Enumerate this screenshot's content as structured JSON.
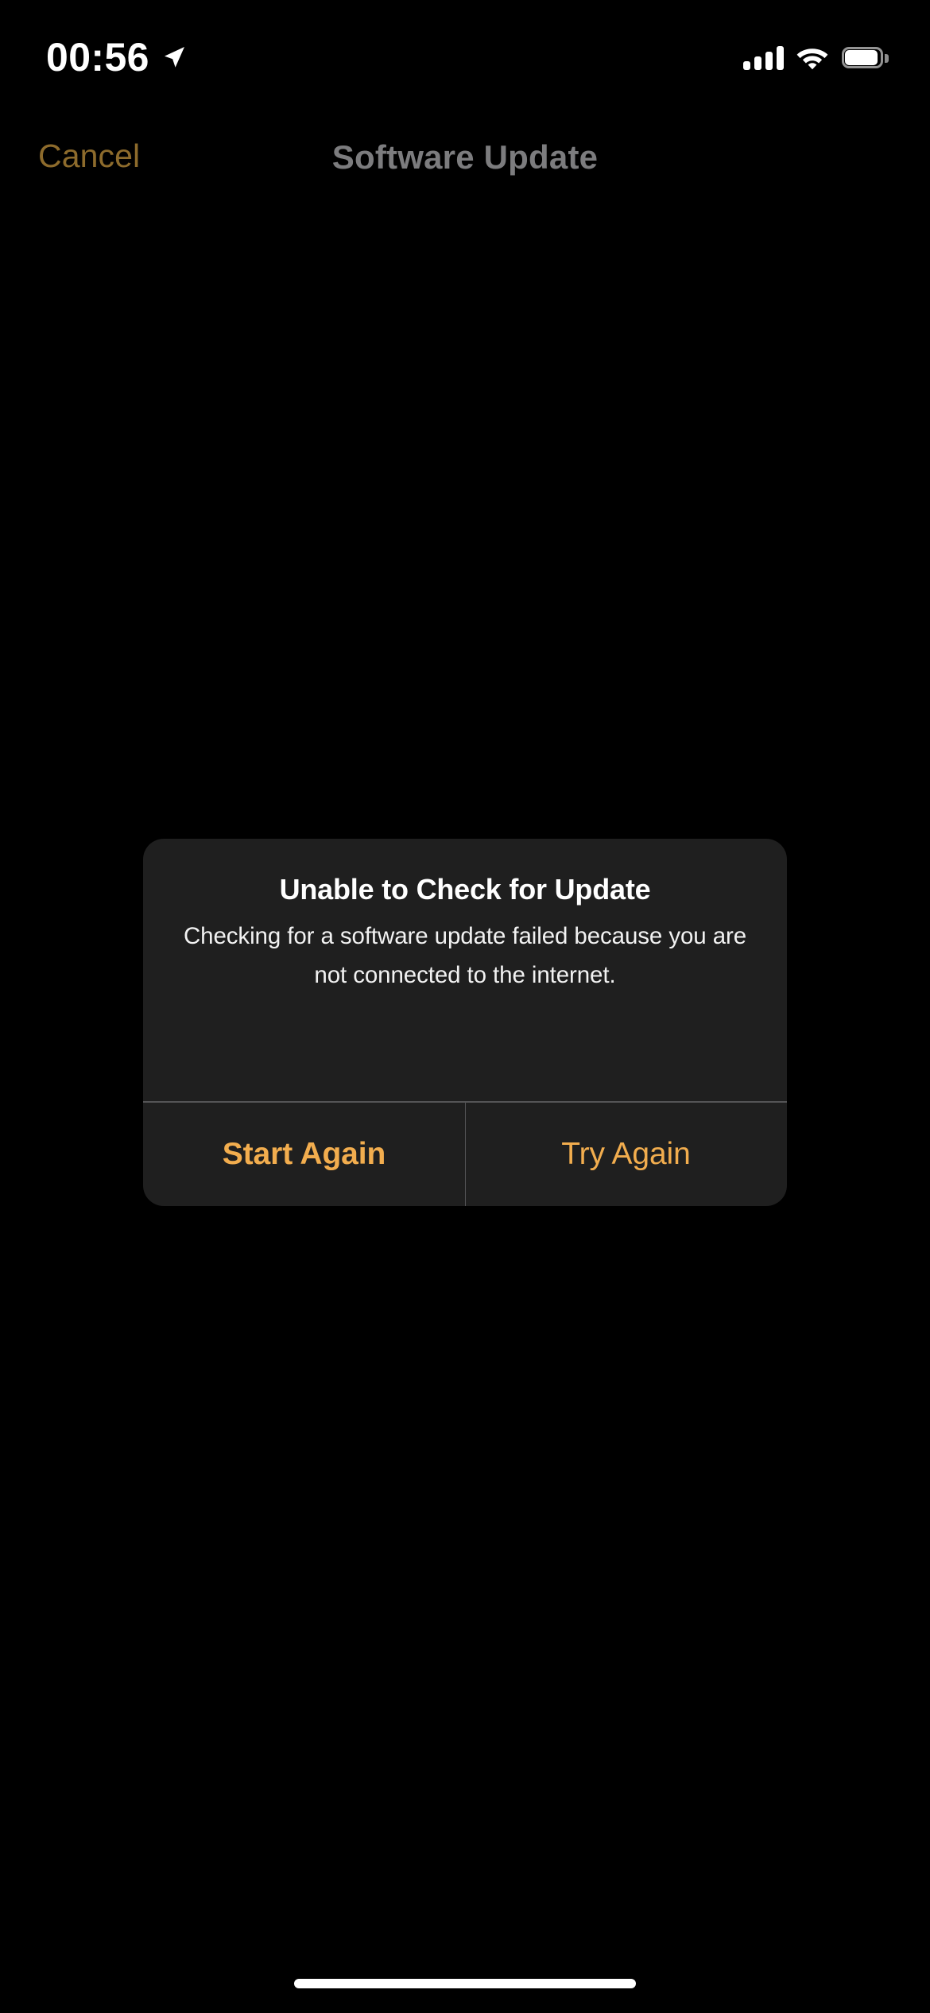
{
  "status_bar": {
    "time": "00:56",
    "location_icon": "location-arrow-icon",
    "cellular_icon": "cellular-signal-icon",
    "cellular_bars_filled": 4,
    "cellular_bars_total": 4,
    "wifi_icon": "wifi-icon",
    "battery_icon": "battery-icon",
    "battery_level_percent": 90
  },
  "nav_bar": {
    "cancel_label": "Cancel",
    "title": "Software Update"
  },
  "alert": {
    "title": "Unable to Check for Update",
    "message": "Checking for a software update failed because you are not connected to the internet.",
    "buttons": [
      {
        "label": "Start Again",
        "style": "preferred"
      },
      {
        "label": "Try Again",
        "style": "default"
      }
    ]
  },
  "home_indicator": {
    "name": "home-indicator"
  },
  "colors": {
    "background": "#000000",
    "alert_background": "#1f1f1f",
    "alert_divider": "#545456",
    "accent_orange": "#f2ad4e",
    "dimmed_accent_orange": "#8d6b2c",
    "dimmed_title_gray": "#7c7c7e",
    "primary_text": "#ffffff"
  }
}
